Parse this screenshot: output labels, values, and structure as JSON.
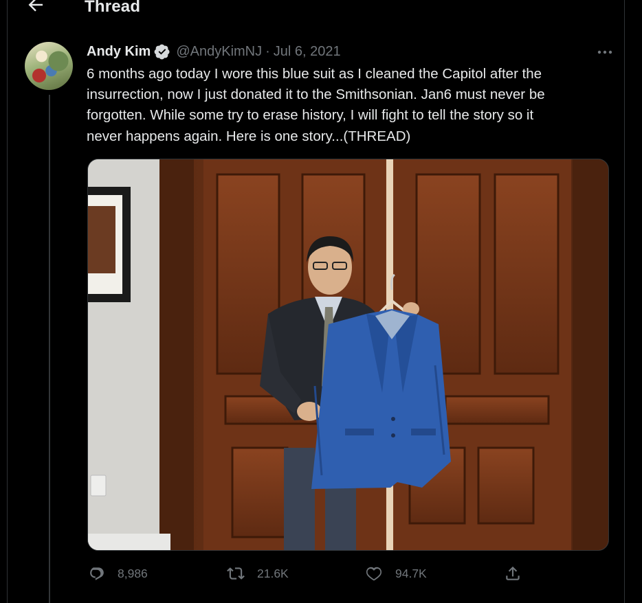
{
  "header": {
    "title": "Thread"
  },
  "tweet": {
    "author_name": "Andy Kim",
    "handle": "@AndyKimNJ",
    "separator": "·",
    "date": "Jul 6, 2021",
    "text": "6 months ago today I wore this blue suit as I cleaned the Capitol after the\ninsurrection, now I just donated it to the Smithsonian. Jan6 must never be\nforgotten. While some try to erase history, I will fight to tell the story so it\nnever happens again. Here is one story...(THREAD)"
  },
  "stats": {
    "replies": "8,986",
    "retweets": "21.6K",
    "likes": "94.7K"
  },
  "colors": {
    "background": "#000000",
    "text": "#e7e9ea",
    "muted": "#71767b",
    "border": "#2f3336",
    "suit_blue": "#2f5fb0"
  },
  "icons": [
    "back-arrow-icon",
    "verified-badge-icon",
    "more-icon",
    "reply-icon",
    "retweet-icon",
    "like-icon",
    "share-icon"
  ]
}
